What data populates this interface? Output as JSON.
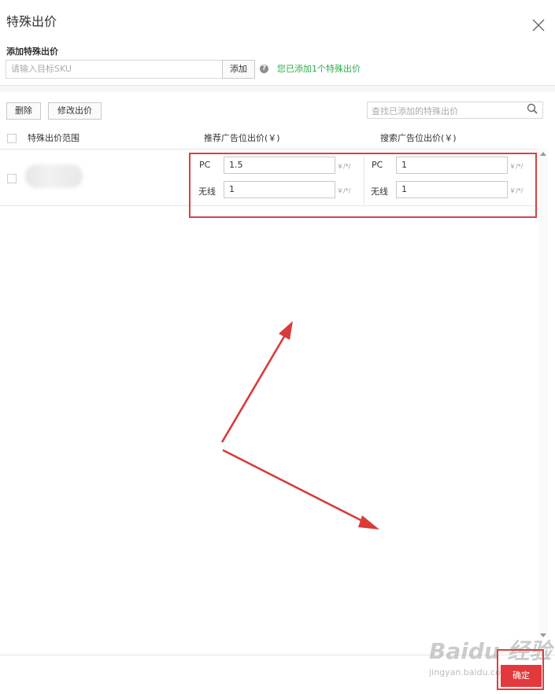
{
  "dialog": {
    "title": "特殊出价",
    "close_icon": "close-icon"
  },
  "add_section": {
    "label": "添加特殊出价",
    "sku_placeholder": "请输入目标SKU",
    "add_button": "添加",
    "help_icon": "help-icon",
    "added_message": "您已添加1个特殊出价"
  },
  "toolbar": {
    "delete_label": "删除",
    "modify_label": "修改出价",
    "search_placeholder": "查找已添加的特殊出价",
    "search_icon": "search-icon"
  },
  "table": {
    "headers": {
      "scope": "特殊出价范围",
      "recommend_bid": "推荐广告位出价(￥)",
      "search_bid": "搜索广告位出价(￥)"
    },
    "rows": [
      {
        "recommend": {
          "pc_label": "PC",
          "pc_value": "1.5",
          "wireless_label": "无线",
          "wireless_value": "1"
        },
        "search": {
          "pc_label": "PC",
          "pc_value": "1",
          "wireless_label": "无线",
          "wireless_value": "1"
        },
        "unit": "￥/*/"
      }
    ]
  },
  "footer": {
    "confirm_label": "确定"
  },
  "watermark": {
    "text": "Baidu 经验",
    "sub": "jingyan.baidu.com"
  },
  "colors": {
    "accent_red": "#e4393c",
    "highlight_red": "#d94040",
    "success_green": "#2eaa4e"
  }
}
